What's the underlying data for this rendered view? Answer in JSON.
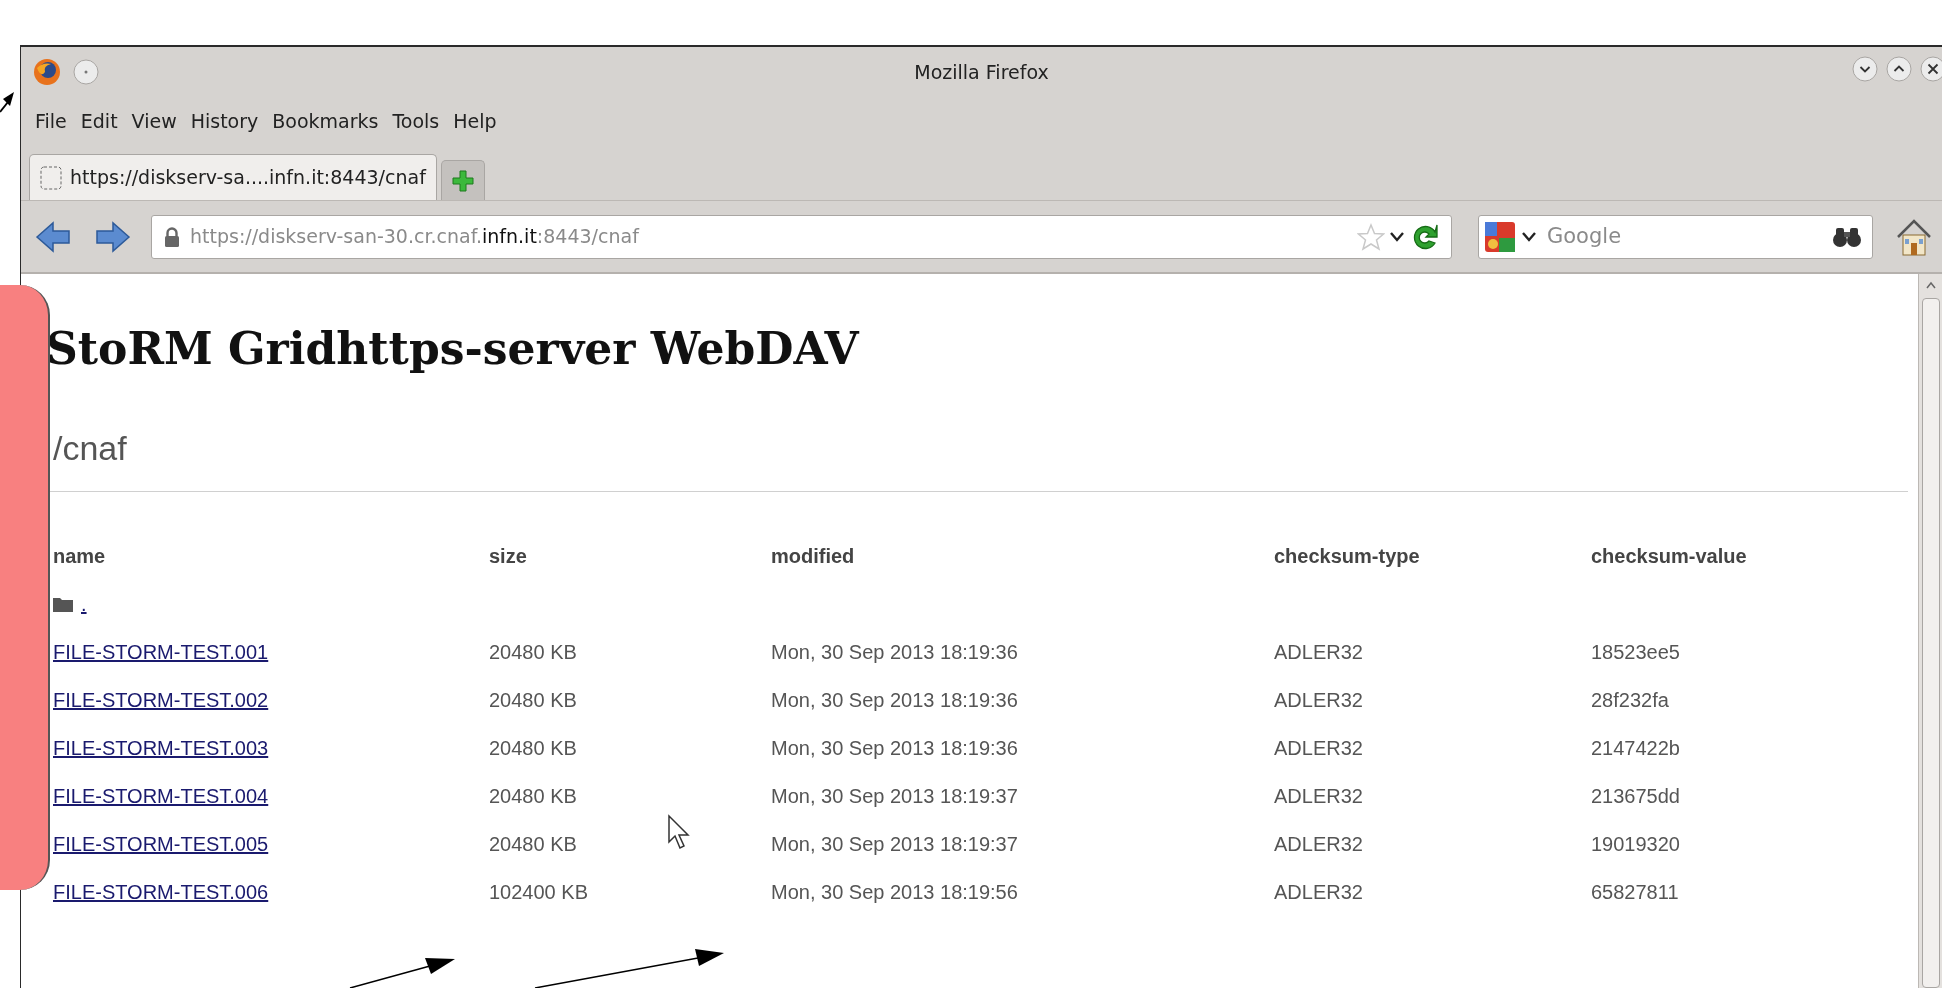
{
  "window": {
    "title": "Mozilla Firefox"
  },
  "menu": [
    "File",
    "Edit",
    "View",
    "History",
    "Bookmarks",
    "Tools",
    "Help"
  ],
  "tabs": [
    {
      "label": "https://diskserv-sa....infn.it:8443/cnaf",
      "selected": true
    }
  ],
  "address_bar": {
    "url": "https://diskserv-san-30.cr.cnaf.**infn.it**:8443/cnaf"
  },
  "search": {
    "placeholder": "Google"
  },
  "page": {
    "heading": "StoRM Gridhttps-server WebDAV",
    "path": "/cnaf",
    "table": {
      "columns": [
        "name",
        "size",
        "modified",
        "checksum-type",
        "checksum-value"
      ],
      "rows": [
        {
          "kind": "folder",
          "name": "."
        },
        {
          "kind": "file",
          "name": "FILE-STORM-TEST.001",
          "size": "20480 KB",
          "modified": "Mon, 30 Sep 2013 18:19:36",
          "checksum_type": "ADLER32",
          "checksum_value": "18523ee5"
        },
        {
          "kind": "file",
          "name": "FILE-STORM-TEST.002",
          "size": "20480 KB",
          "modified": "Mon, 30 Sep 2013 18:19:36",
          "checksum_type": "ADLER32",
          "checksum_value": "28f232fa"
        },
        {
          "kind": "file",
          "name": "FILE-STORM-TEST.003",
          "size": "20480 KB",
          "modified": "Mon, 30 Sep 2013 18:19:36",
          "checksum_type": "ADLER32",
          "checksum_value": "2147422b"
        },
        {
          "kind": "file",
          "name": "FILE-STORM-TEST.004",
          "size": "20480 KB",
          "modified": "Mon, 30 Sep 2013 18:19:37",
          "checksum_type": "ADLER32",
          "checksum_value": "213675dd"
        },
        {
          "kind": "file",
          "name": "FILE-STORM-TEST.005",
          "size": "20480 KB",
          "modified": "Mon, 30 Sep 2013 18:19:37",
          "checksum_type": "ADLER32",
          "checksum_value": "19019320"
        },
        {
          "kind": "file",
          "name": "FILE-STORM-TEST.006",
          "size": "102400 KB",
          "modified": "Mon, 30 Sep 2013 18:19:56",
          "checksum_type": "ADLER32",
          "checksum_value": "65827811"
        }
      ]
    }
  }
}
